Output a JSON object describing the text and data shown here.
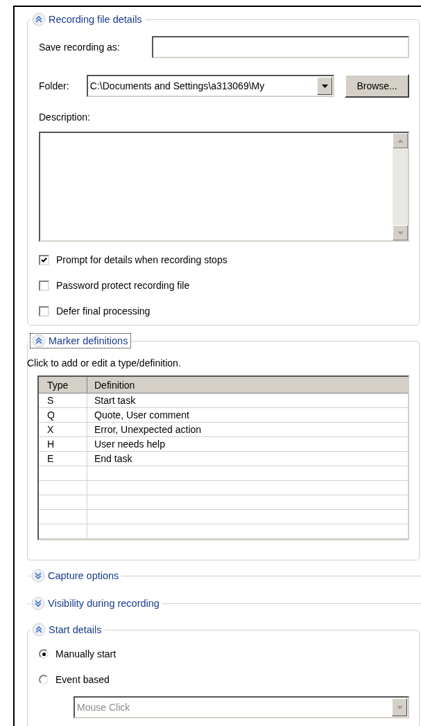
{
  "file_details": {
    "title": "Recording file details",
    "expanded": true,
    "save_as": {
      "label": "Save recording as:"
    },
    "folder": {
      "label": "Folder:",
      "value": "C:\\Documents and Settings\\a313069\\My"
    },
    "browse_button": "Browse...",
    "description": {
      "label": "Description:"
    },
    "options": [
      {
        "label": "Prompt for details when recording stops",
        "checked": true
      },
      {
        "label": "Password protect recording file",
        "checked": false
      },
      {
        "label": "Defer final processing",
        "checked": false
      }
    ]
  },
  "marker_definitions": {
    "title": "Marker definitions",
    "expanded": true,
    "focused": true,
    "hint": "Click to add or edit a type/definition.",
    "table": {
      "columns": [
        "Type",
        "Definition"
      ],
      "rows": [
        [
          "S",
          "Start task"
        ],
        [
          "Q",
          "Quote, User comment"
        ],
        [
          "X",
          "Error, Unexpected action"
        ],
        [
          "H",
          "User needs help"
        ],
        [
          "E",
          "End task"
        ]
      ]
    }
  },
  "capture_options": {
    "title": "Capture options",
    "expanded": false
  },
  "visibility": {
    "title": "Visibility during recording",
    "expanded": false
  },
  "start_details": {
    "title": "Start details",
    "expanded": true,
    "options": [
      {
        "label": "Manually start",
        "selected": true
      },
      {
        "label": "Event based",
        "selected": false
      }
    ],
    "event": {
      "value": "Mouse Click",
      "disabled": true
    }
  }
}
